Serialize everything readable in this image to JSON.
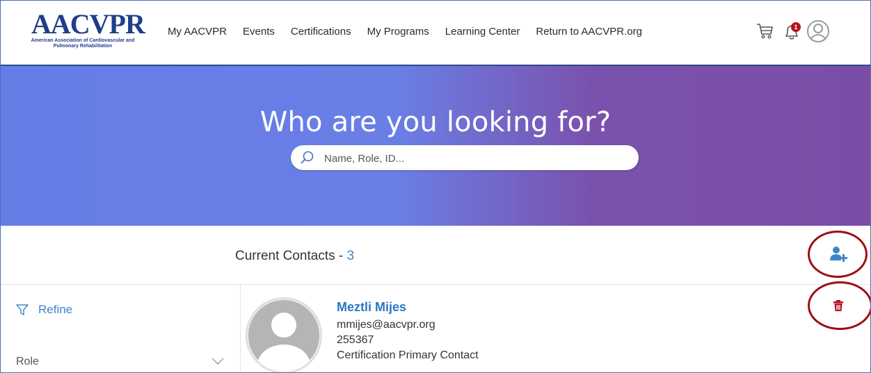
{
  "header": {
    "logo_text": "AACVPR",
    "logo_subtitle": "American Association of Cardiovascular and Pulmonary Rehabilitation",
    "nav": [
      {
        "label": "My AACVPR"
      },
      {
        "label": "Events"
      },
      {
        "label": "Certifications"
      },
      {
        "label": "My Programs"
      },
      {
        "label": "Learning Center"
      },
      {
        "label": "Return to AACVPR.org"
      }
    ],
    "icons": [
      "cart-icon",
      "bell-icon",
      "avatar-icon"
    ],
    "notification_count": "1"
  },
  "hero": {
    "title": "Who are you looking for?",
    "search_placeholder": "Name, Role, ID..."
  },
  "contacts": {
    "title": "Current Contacts - ",
    "count": "3"
  },
  "sidebar": {
    "refine_label": "Refine",
    "role_label": "Role"
  },
  "contact": {
    "name": "Meztli Mijes",
    "email": "mmijes@aacvpr.org",
    "id": "255367",
    "role": "Certification Primary Contact"
  },
  "colors": {
    "brand": "#1f3e8a",
    "link": "#3f86c9",
    "badge": "#b3121f",
    "annotation_circle": "#9e0d14"
  }
}
